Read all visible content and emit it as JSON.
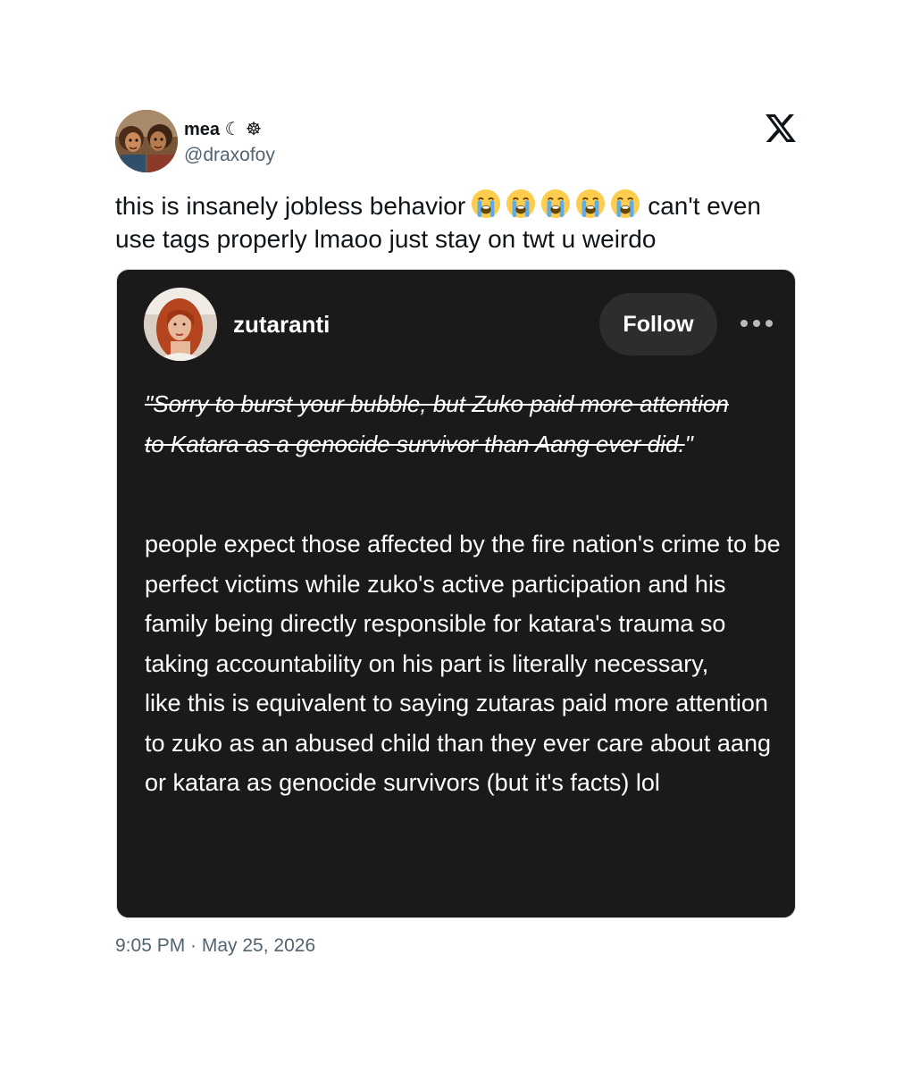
{
  "author": {
    "display_name": "mea ☾ ☸",
    "handle": "@draxofoy",
    "avatar_icon": "illustrated-avatar"
  },
  "platform_logo": "x-logo-icon",
  "tweet": {
    "text_before_emoji": "this is insanely jobless behavior",
    "emoji": [
      "😭",
      "😭",
      "😭",
      "😭",
      "😭"
    ],
    "text_after_emoji": "can't even use tags properly lmaoo just stay on twt u weirdo",
    "timestamp": "9:05 PM · May 25, 2026"
  },
  "embedded_post": {
    "username": "zutaranti",
    "follow_label": "Follow",
    "more_icon": "ellipsis-icon",
    "quote_open": "\"",
    "quoted_text": "Sorry to burst your bubble, but Zuko paid more attention to Katara as a genocide survivor than Aang ever did.",
    "quote_close": "\"",
    "body_paragraph_1": "people expect those affected by the fire nation's crime to be perfect victims while zuko's active participation and his family being directly responsible for katara's trauma so taking accountability on his part is literally necessary,",
    "body_paragraph_2": "like this is equivalent to saying zutaras paid more attention to zuko as an abused child than they ever care about aang or katara as genocide survivors (but it's facts) lol",
    "colors": {
      "card_background": "#1a1a1a",
      "follow_button_background": "#2d2d2d",
      "text": "#ffffff"
    }
  },
  "colors": {
    "primary_text": "#0f1419",
    "secondary_text": "#536471"
  }
}
